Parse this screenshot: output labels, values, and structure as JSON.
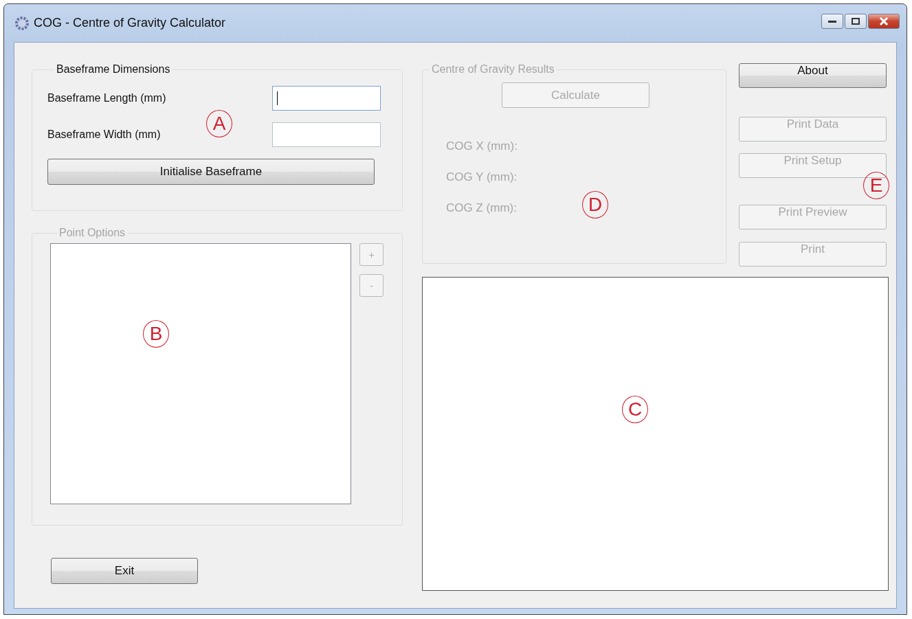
{
  "window": {
    "title": "COG - Centre of Gravity Calculator"
  },
  "baseframe_group": {
    "title": "Baseframe Dimensions",
    "disabled": false,
    "fields": [
      {
        "label": "Baseframe Length (mm)",
        "focused": true
      },
      {
        "label": "Baseframe Width (mm)",
        "focused": false
      }
    ],
    "button": {
      "label": "Initialise Baseframe",
      "disabled": false
    },
    "annotation": "A"
  },
  "point_options_group": {
    "title": "Point Options",
    "disabled": true,
    "buttons": [
      {
        "label": "+",
        "disabled": true
      },
      {
        "label": "-",
        "disabled": true
      }
    ],
    "annotation": "B"
  },
  "exit_button": {
    "label": "Exit",
    "disabled": false
  },
  "results_group": {
    "title": "Centre of Gravity Results",
    "disabled": true,
    "button": {
      "label": "Calculate",
      "disabled": true
    },
    "labels": [
      "COG X (mm):",
      "COG Y (mm):",
      "COG Z (mm):"
    ],
    "annotation": "D"
  },
  "side_buttons": [
    {
      "label": "About",
      "disabled": false
    },
    {
      "label": "Print Data",
      "disabled": true
    },
    {
      "label": "Print Setup",
      "disabled": true
    },
    {
      "label": "Print Preview",
      "disabled": true
    },
    {
      "label": "Print",
      "disabled": true
    }
  ],
  "side_annotation": "E",
  "canvas": {
    "annotation": "C"
  }
}
